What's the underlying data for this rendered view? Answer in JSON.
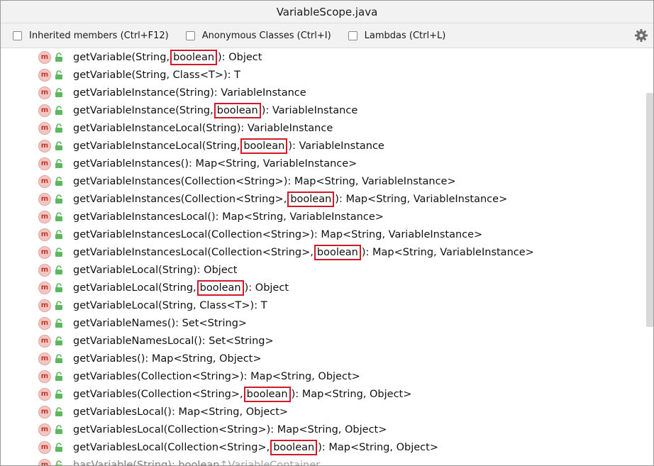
{
  "title": "VariableScope.java",
  "toolbar": {
    "inherited_label": "Inherited members (Ctrl+F12)",
    "anonymous_label": "Anonymous Classes (Ctrl+I)",
    "lambdas_label": "Lambdas (Ctrl+L)"
  },
  "icons": {
    "method_glyph": "m",
    "method_color": "#f2c6c2",
    "lock_color": "#5cb85c",
    "highlight_color": "#d1192a"
  },
  "methods": [
    {
      "pre": "getVariable(String,",
      "hl": "boolean",
      "post": "): Object"
    },
    {
      "pre": "getVariable(String, Class<T>): T",
      "hl": "",
      "post": ""
    },
    {
      "pre": "getVariableInstance(String): VariableInstance",
      "hl": "",
      "post": ""
    },
    {
      "pre": "getVariableInstance(String,",
      "hl": "boolean",
      "post": "): VariableInstance"
    },
    {
      "pre": "getVariableInstanceLocal(String): VariableInstance",
      "hl": "",
      "post": ""
    },
    {
      "pre": "getVariableInstanceLocal(String,",
      "hl": "boolean",
      "post": "): VariableInstance"
    },
    {
      "pre": "getVariableInstances(): Map<String, VariableInstance>",
      "hl": "",
      "post": ""
    },
    {
      "pre": "getVariableInstances(Collection<String>): Map<String, VariableInstance>",
      "hl": "",
      "post": ""
    },
    {
      "pre": "getVariableInstances(Collection<String>,",
      "hl": "boolean",
      "post": "): Map<String, VariableInstance>"
    },
    {
      "pre": "getVariableInstancesLocal(): Map<String, VariableInstance>",
      "hl": "",
      "post": ""
    },
    {
      "pre": "getVariableInstancesLocal(Collection<String>): Map<String, VariableInstance>",
      "hl": "",
      "post": ""
    },
    {
      "pre": "getVariableInstancesLocal(Collection<String>,",
      "hl": "boolean",
      "post": "): Map<String, VariableInstance>"
    },
    {
      "pre": "getVariableLocal(String): Object",
      "hl": "",
      "post": ""
    },
    {
      "pre": "getVariableLocal(String,",
      "hl": "boolean",
      "post": "): Object"
    },
    {
      "pre": "getVariableLocal(String, Class<T>): T",
      "hl": "",
      "post": ""
    },
    {
      "pre": "getVariableNames(): Set<String>",
      "hl": "",
      "post": ""
    },
    {
      "pre": "getVariableNamesLocal(): Set<String>",
      "hl": "",
      "post": ""
    },
    {
      "pre": "getVariables(): Map<String, Object>",
      "hl": "",
      "post": ""
    },
    {
      "pre": "getVariables(Collection<String>): Map<String, Object>",
      "hl": "",
      "post": ""
    },
    {
      "pre": "getVariables(Collection<String>,",
      "hl": "boolean",
      "post": "): Map<String, Object>"
    },
    {
      "pre": "getVariablesLocal(): Map<String, Object>",
      "hl": "",
      "post": ""
    },
    {
      "pre": "getVariablesLocal(Collection<String>): Map<String, Object>",
      "hl": "",
      "post": ""
    },
    {
      "pre": "getVariablesLocal(Collection<String>,",
      "hl": "boolean",
      "post": "): Map<String, Object>"
    }
  ],
  "last_row": {
    "text": "hasVariable(String): boolean",
    "extra": "↑VariableContainer"
  }
}
